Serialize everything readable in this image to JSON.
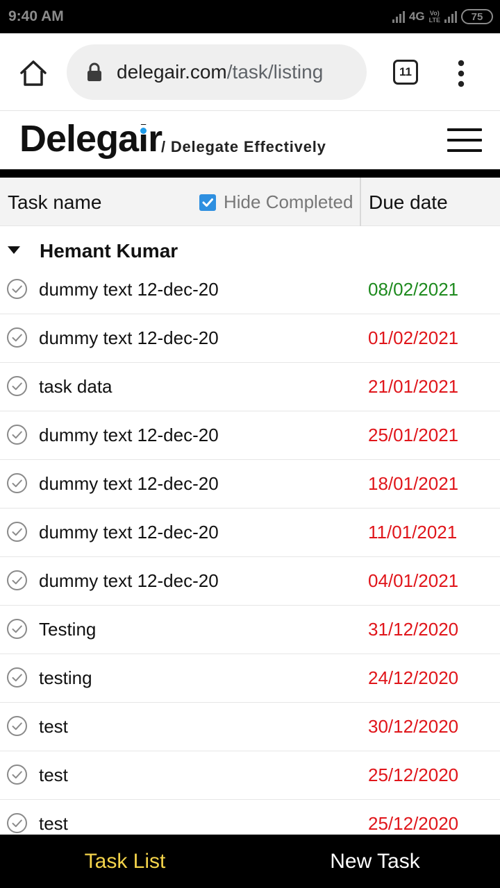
{
  "status_bar": {
    "time": "9:40 AM",
    "network": "4G",
    "volte_top": "Vo)",
    "volte_bottom": "LTE",
    "battery": "75"
  },
  "browser": {
    "url_domain": "delegair.com",
    "url_path": "/task/listing",
    "tab_count": "11"
  },
  "site": {
    "logo_part1": "Delega",
    "logo_i": "i",
    "logo_part2": "r",
    "logo_dot_color": "#1e9be9",
    "tagline": "/ Delegate Effectively"
  },
  "table_header": {
    "task_name": "Task name",
    "hide_completed": "Hide Completed",
    "hide_completed_checked": true,
    "due_date": "Due date"
  },
  "group": {
    "name": "Hemant Kumar"
  },
  "colors": {
    "on_time": "#1e8a1e",
    "overdue": "#e0151a",
    "accent": "#f3d34a",
    "checkbox": "#2e8fe0"
  },
  "tasks": [
    {
      "name": "dummy text 12-dec-20",
      "due": "08/02/2021",
      "status": "on_time"
    },
    {
      "name": "dummy text 12-dec-20",
      "due": "01/02/2021",
      "status": "overdue"
    },
    {
      "name": "task data",
      "due": "21/01/2021",
      "status": "overdue"
    },
    {
      "name": "dummy text 12-dec-20",
      "due": "25/01/2021",
      "status": "overdue"
    },
    {
      "name": "dummy text 12-dec-20",
      "due": "18/01/2021",
      "status": "overdue"
    },
    {
      "name": "dummy text 12-dec-20",
      "due": "11/01/2021",
      "status": "overdue"
    },
    {
      "name": "dummy text 12-dec-20",
      "due": "04/01/2021",
      "status": "overdue"
    },
    {
      "name": "Testing",
      "due": "31/12/2020",
      "status": "overdue"
    },
    {
      "name": "testing",
      "due": "24/12/2020",
      "status": "overdue"
    },
    {
      "name": "test",
      "due": "30/12/2020",
      "status": "overdue"
    },
    {
      "name": "test",
      "due": "25/12/2020",
      "status": "overdue"
    },
    {
      "name": "test",
      "due": "25/12/2020",
      "status": "overdue"
    }
  ],
  "bottom_nav": {
    "task_list": "Task List",
    "new_task": "New Task",
    "active": "task_list"
  }
}
